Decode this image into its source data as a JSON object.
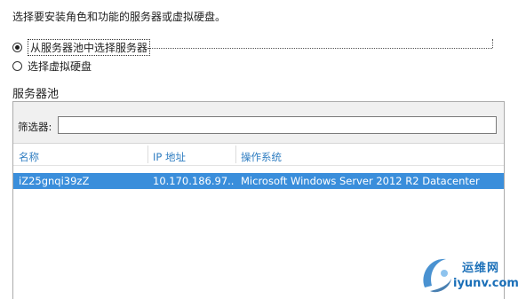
{
  "instruction": "选择要安装角色和功能的服务器或虚拟硬盘。",
  "options": [
    {
      "label": "从服务器池中选择服务器",
      "checked": true
    },
    {
      "label": "选择虚拟硬盘",
      "checked": false
    }
  ],
  "server_pool": {
    "section_label": "服务器池",
    "filter_label": "筛选器:",
    "filter_value": "",
    "columns": [
      "名称",
      "IP 地址",
      "操作系统"
    ],
    "rows": [
      {
        "name": "iZ25gnqi39zZ",
        "ip": "10.170.186.97...",
        "os": "Microsoft Windows Server 2012 R2 Datacenter",
        "selected": true
      }
    ]
  },
  "watermark": {
    "cn": "运维网",
    "en": "iyunv.com"
  },
  "colors": {
    "header_text": "#2f7dc1",
    "selection": "#3a8edb"
  }
}
